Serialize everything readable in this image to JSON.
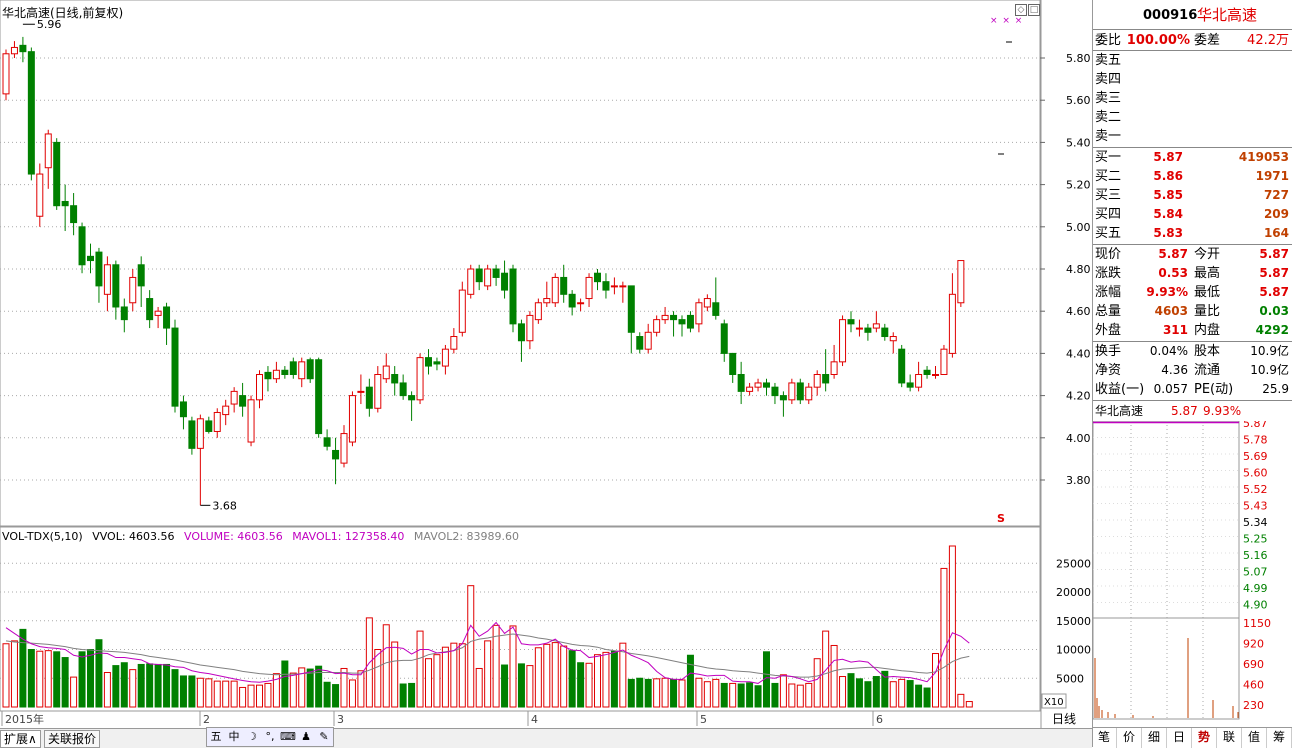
{
  "chart": {
    "title": "华北高速(日线,前复权)",
    "high_label": "5.96",
    "low_label": "3.68",
    "price_ticks": [
      "5.80",
      "5.60",
      "5.40",
      "5.20",
      "5.00",
      "4.80",
      "4.60",
      "4.40",
      "4.20",
      "4.00",
      "3.80"
    ],
    "vol_ticks": [
      "25000",
      "20000",
      "15000",
      "10000",
      "5000"
    ],
    "vol_unit": "X10",
    "x_labels": [
      "2015年",
      "2",
      "3",
      "4",
      "5",
      "6"
    ],
    "period_label": "日线",
    "vol_header": {
      "name": "VOL-TDX(5,10)",
      "vvol": "VVOL: 4603.56",
      "volume": "VOLUME: 4603.56",
      "mavol1": "MAVOL1: 127358.40",
      "mavol2": "MAVOL2: 83989.60"
    },
    "signal": "S",
    "markers": "× × ×",
    "colors": {
      "up": "#e00000",
      "down": "#008000",
      "ma1": "#c000c0",
      "ma2": "#808080"
    }
  },
  "chart_data": {
    "type": "candlestick",
    "title": "华北高速(日线,前复权)",
    "ylim": [
      3.68,
      5.96
    ],
    "candles": [
      [
        5.63,
        5.82,
        5.6,
        5.84
      ],
      [
        5.82,
        5.85,
        5.8,
        5.88
      ],
      [
        5.86,
        5.83,
        5.78,
        5.9
      ],
      [
        5.83,
        5.25,
        5.22,
        5.85
      ],
      [
        5.05,
        5.25,
        5.0,
        5.3
      ],
      [
        5.28,
        5.44,
        5.18,
        5.46
      ],
      [
        5.4,
        5.1,
        5.08,
        5.42
      ],
      [
        5.12,
        5.1,
        4.98,
        5.2
      ],
      [
        5.1,
        5.02,
        4.96,
        5.16
      ],
      [
        5.0,
        4.82,
        4.78,
        5.02
      ],
      [
        4.86,
        4.84,
        4.78,
        4.92
      ],
      [
        4.88,
        4.72,
        4.64,
        4.9
      ],
      [
        4.68,
        4.82,
        4.6,
        4.86
      ],
      [
        4.82,
        4.62,
        4.56,
        4.84
      ],
      [
        4.62,
        4.56,
        4.5,
        4.66
      ],
      [
        4.64,
        4.76,
        4.6,
        4.8
      ],
      [
        4.82,
        4.72,
        4.62,
        4.86
      ],
      [
        4.66,
        4.56,
        4.52,
        4.7
      ],
      [
        4.58,
        4.6,
        4.52,
        4.62
      ],
      [
        4.62,
        4.52,
        4.44,
        4.64
      ],
      [
        4.52,
        4.15,
        4.12,
        4.56
      ],
      [
        4.17,
        4.1,
        4.04,
        4.2
      ],
      [
        4.08,
        3.95,
        3.92,
        4.1
      ],
      [
        3.95,
        4.09,
        3.68,
        4.11
      ],
      [
        4.08,
        4.03,
        4.02,
        4.1
      ],
      [
        4.03,
        4.12,
        4.0,
        4.14
      ],
      [
        4.11,
        4.15,
        4.06,
        4.18
      ],
      [
        4.16,
        4.22,
        4.12,
        4.24
      ],
      [
        4.2,
        4.15,
        4.1,
        4.26
      ],
      [
        3.98,
        4.18,
        3.96,
        4.2
      ],
      [
        4.18,
        4.3,
        4.14,
        4.32
      ],
      [
        4.31,
        4.28,
        4.22,
        4.34
      ],
      [
        4.28,
        4.32,
        4.26,
        4.36
      ],
      [
        4.32,
        4.3,
        4.28,
        4.34
      ],
      [
        4.36,
        4.3,
        4.28,
        4.38
      ],
      [
        4.28,
        4.36,
        4.24,
        4.38
      ],
      [
        4.37,
        4.28,
        4.26,
        4.38
      ],
      [
        4.37,
        4.02,
        4.0,
        4.38
      ],
      [
        4.0,
        3.96,
        3.94,
        4.04
      ],
      [
        3.94,
        3.9,
        3.78,
        4.0
      ],
      [
        3.88,
        4.02,
        3.86,
        4.06
      ],
      [
        3.98,
        4.2,
        3.96,
        4.22
      ],
      [
        4.22,
        4.22,
        4.16,
        4.3
      ],
      [
        4.24,
        4.14,
        4.1,
        4.28
      ],
      [
        4.14,
        4.3,
        4.12,
        4.34
      ],
      [
        4.28,
        4.34,
        4.26,
        4.4
      ],
      [
        4.3,
        4.26,
        4.2,
        4.34
      ],
      [
        4.26,
        4.2,
        4.18,
        4.3
      ],
      [
        4.2,
        4.18,
        4.08,
        4.22
      ],
      [
        4.18,
        4.38,
        4.16,
        4.4
      ],
      [
        4.38,
        4.34,
        4.3,
        4.42
      ],
      [
        4.36,
        4.35,
        4.32,
        4.38
      ],
      [
        4.34,
        4.42,
        4.3,
        4.44
      ],
      [
        4.42,
        4.48,
        4.4,
        4.52
      ],
      [
        4.5,
        4.7,
        4.48,
        4.74
      ],
      [
        4.68,
        4.8,
        4.66,
        4.82
      ],
      [
        4.8,
        4.74,
        4.7,
        4.82
      ],
      [
        4.72,
        4.8,
        4.7,
        4.82
      ],
      [
        4.8,
        4.76,
        4.72,
        4.82
      ],
      [
        4.78,
        4.7,
        4.66,
        4.84
      ],
      [
        4.8,
        4.54,
        4.5,
        4.82
      ],
      [
        4.54,
        4.46,
        4.36,
        4.56
      ],
      [
        4.46,
        4.58,
        4.42,
        4.6
      ],
      [
        4.56,
        4.64,
        4.54,
        4.66
      ],
      [
        4.64,
        4.66,
        4.62,
        4.74
      ],
      [
        4.64,
        4.76,
        4.62,
        4.78
      ],
      [
        4.76,
        4.68,
        4.64,
        4.82
      ],
      [
        4.68,
        4.62,
        4.58,
        4.7
      ],
      [
        4.64,
        4.64,
        4.6,
        4.66
      ],
      [
        4.66,
        4.76,
        4.62,
        4.78
      ],
      [
        4.78,
        4.74,
        4.7,
        4.8
      ],
      [
        4.74,
        4.7,
        4.66,
        4.78
      ],
      [
        4.72,
        4.72,
        4.68,
        4.76
      ],
      [
        4.72,
        4.72,
        4.64,
        4.74
      ],
      [
        4.72,
        4.5,
        4.4,
        4.72
      ],
      [
        4.48,
        4.42,
        4.4,
        4.5
      ],
      [
        4.42,
        4.5,
        4.4,
        4.54
      ],
      [
        4.5,
        4.56,
        4.48,
        4.58
      ],
      [
        4.56,
        4.58,
        4.54,
        4.62
      ],
      [
        4.58,
        4.56,
        4.48,
        4.6
      ],
      [
        4.56,
        4.54,
        4.48,
        4.58
      ],
      [
        4.58,
        4.52,
        4.5,
        4.6
      ],
      [
        4.54,
        4.64,
        4.5,
        4.66
      ],
      [
        4.62,
        4.66,
        4.6,
        4.68
      ],
      [
        4.64,
        4.58,
        4.56,
        4.76
      ],
      [
        4.54,
        4.4,
        4.36,
        4.56
      ],
      [
        4.4,
        4.3,
        4.26,
        4.4
      ],
      [
        4.3,
        4.22,
        4.16,
        4.36
      ],
      [
        4.22,
        4.24,
        4.2,
        4.26
      ],
      [
        4.24,
        4.26,
        4.22,
        4.28
      ],
      [
        4.26,
        4.24,
        4.2,
        4.28
      ],
      [
        4.24,
        4.2,
        4.16,
        4.26
      ],
      [
        4.2,
        4.18,
        4.1,
        4.22
      ],
      [
        4.18,
        4.26,
        4.16,
        4.28
      ],
      [
        4.26,
        4.18,
        4.16,
        4.28
      ],
      [
        4.18,
        4.24,
        4.16,
        4.26
      ],
      [
        4.24,
        4.3,
        4.2,
        4.32
      ],
      [
        4.3,
        4.26,
        4.22,
        4.42
      ],
      [
        4.3,
        4.36,
        4.28,
        4.44
      ],
      [
        4.36,
        4.56,
        4.34,
        4.58
      ],
      [
        4.56,
        4.54,
        4.5,
        4.6
      ],
      [
        4.52,
        4.52,
        4.48,
        4.56
      ],
      [
        4.52,
        4.5,
        4.46,
        4.54
      ],
      [
        4.52,
        4.54,
        4.5,
        4.6
      ],
      [
        4.52,
        4.48,
        4.46,
        4.54
      ],
      [
        4.46,
        4.48,
        4.4,
        4.5
      ],
      [
        4.42,
        4.26,
        4.24,
        4.44
      ],
      [
        4.26,
        4.24,
        4.22,
        4.3
      ],
      [
        4.24,
        4.3,
        4.22,
        4.36
      ],
      [
        4.32,
        4.3,
        4.28,
        4.34
      ],
      [
        4.3,
        4.3,
        4.28,
        4.34
      ],
      [
        4.3,
        4.42,
        4.3,
        4.44
      ],
      [
        4.4,
        4.68,
        4.38,
        4.78
      ],
      [
        4.64,
        4.84,
        4.62,
        4.84
      ]
    ],
    "volumes": [
      [
        11000,
        1
      ],
      [
        11500,
        1
      ],
      [
        13500,
        0
      ],
      [
        10000,
        0
      ],
      [
        9700,
        1
      ],
      [
        9800,
        1
      ],
      [
        9600,
        0
      ],
      [
        8600,
        0
      ],
      [
        5200,
        1
      ],
      [
        9600,
        0
      ],
      [
        10000,
        0
      ],
      [
        11700,
        0
      ],
      [
        6000,
        1
      ],
      [
        7200,
        0
      ],
      [
        7700,
        0
      ],
      [
        6500,
        1
      ],
      [
        7400,
        0
      ],
      [
        7500,
        0
      ],
      [
        7400,
        0
      ],
      [
        7400,
        0
      ],
      [
        6500,
        0
      ],
      [
        5400,
        0
      ],
      [
        5400,
        0
      ],
      [
        5000,
        1
      ],
      [
        4900,
        1
      ],
      [
        4500,
        1
      ],
      [
        4500,
        1
      ],
      [
        4500,
        1
      ],
      [
        3400,
        1
      ],
      [
        3800,
        1
      ],
      [
        3800,
        1
      ],
      [
        4100,
        1
      ],
      [
        5800,
        1
      ],
      [
        8000,
        0
      ],
      [
        5900,
        1
      ],
      [
        6800,
        1
      ],
      [
        6600,
        0
      ],
      [
        7100,
        0
      ],
      [
        4300,
        0
      ],
      [
        3900,
        0
      ],
      [
        6700,
        1
      ],
      [
        4700,
        1
      ],
      [
        6300,
        1
      ],
      [
        15500,
        1
      ],
      [
        10000,
        1
      ],
      [
        14300,
        1
      ],
      [
        11300,
        1
      ],
      [
        4000,
        0
      ],
      [
        4100,
        0
      ],
      [
        13200,
        1
      ],
      [
        8400,
        1
      ],
      [
        9100,
        1
      ],
      [
        10400,
        1
      ],
      [
        11100,
        1
      ],
      [
        11000,
        1
      ],
      [
        21100,
        1
      ],
      [
        6700,
        1
      ],
      [
        11500,
        1
      ],
      [
        14200,
        1
      ],
      [
        7300,
        0
      ],
      [
        14100,
        1
      ],
      [
        7500,
        0
      ],
      [
        7200,
        1
      ],
      [
        10300,
        1
      ],
      [
        10900,
        1
      ],
      [
        11200,
        1
      ],
      [
        10600,
        1
      ],
      [
        9800,
        0
      ],
      [
        7700,
        0
      ],
      [
        7600,
        1
      ],
      [
        9100,
        1
      ],
      [
        9500,
        1
      ],
      [
        9700,
        0
      ],
      [
        11100,
        1
      ],
      [
        4800,
        0
      ],
      [
        5000,
        0
      ],
      [
        4800,
        0
      ],
      [
        4900,
        1
      ],
      [
        5000,
        1
      ],
      [
        4800,
        0
      ],
      [
        4700,
        1
      ],
      [
        9000,
        0
      ],
      [
        5000,
        1
      ],
      [
        4400,
        1
      ],
      [
        4800,
        1
      ],
      [
        4100,
        0
      ],
      [
        4100,
        1
      ],
      [
        4000,
        0
      ],
      [
        4200,
        0
      ],
      [
        3700,
        0
      ],
      [
        9600,
        0
      ],
      [
        4100,
        0
      ],
      [
        5600,
        1
      ],
      [
        4000,
        1
      ],
      [
        3800,
        1
      ],
      [
        4100,
        1
      ],
      [
        8400,
        1
      ],
      [
        13200,
        1
      ],
      [
        10700,
        1
      ],
      [
        5300,
        1
      ],
      [
        5800,
        0
      ],
      [
        4900,
        0
      ],
      [
        4400,
        0
      ],
      [
        5300,
        0
      ],
      [
        6200,
        0
      ],
      [
        4400,
        1
      ],
      [
        4800,
        1
      ],
      [
        4600,
        0
      ],
      [
        3800,
        0
      ],
      [
        3300,
        0
      ],
      [
        9300,
        1
      ],
      [
        24100,
        1
      ],
      [
        28000,
        1
      ],
      [
        2200,
        1
      ],
      [
        950,
        1
      ]
    ],
    "mavol1": [
      13800,
      12800,
      11800,
      11000,
      10500,
      10300,
      10200,
      10000,
      9000,
      8700,
      9000,
      9400,
      9300,
      8600,
      8600,
      8400,
      8200,
      7500,
      7400,
      7300,
      7000,
      6900,
      6300,
      6000,
      5800,
      5500,
      5200,
      4900,
      4600,
      4400,
      4300,
      4500,
      4800,
      5300,
      5500,
      5800,
      6100,
      6500,
      6300,
      5800,
      5900,
      5600,
      5600,
      7700,
      9100,
      10300,
      10400,
      10200,
      9200,
      10000,
      10000,
      9400,
      9500,
      9800,
      11000,
      14200,
      12300,
      13200,
      14700,
      12800,
      13900,
      11000,
      10800,
      10800,
      11100,
      11800,
      10500,
      9900,
      9800,
      8600,
      8800,
      9100,
      9500,
      9900,
      9000,
      8400,
      7700,
      6200,
      5100,
      4800,
      4800,
      5900,
      5700,
      5400,
      5500,
      5500,
      4500,
      4400,
      4400,
      4100,
      5100,
      5000,
      5500,
      5300,
      4900,
      4400,
      4800,
      6400,
      8100,
      8300,
      7800,
      8000,
      7800,
      6500,
      5200,
      5300,
      5200,
      5100,
      4800,
      4400,
      6000,
      9900,
      12900,
      12300,
      11100
    ],
    "mavol2": [
      11500,
      11300,
      11200,
      11100,
      11000,
      10900,
      10700,
      10500,
      10200,
      10000,
      9900,
      9800,
      9700,
      9600,
      9500,
      9300,
      9100,
      8800,
      8600,
      8400,
      8200,
      7900,
      7600,
      7300,
      7100,
      6900,
      6700,
      6500,
      6200,
      6000,
      5800,
      5700,
      5600,
      5700,
      5700,
      5800,
      5900,
      6000,
      6000,
      6000,
      6000,
      5900,
      5900,
      6400,
      7000,
      7700,
      8000,
      8100,
      8100,
      8500,
      9100,
      9400,
      9600,
      9800,
      10300,
      11400,
      11800,
      12000,
      12300,
      12500,
      12700,
      12500,
      12300,
      12000,
      11800,
      11500,
      11200,
      10900,
      10700,
      10600,
      10400,
      10000,
      9800,
      9600,
      9300,
      9100,
      8900,
      8600,
      8300,
      8000,
      7700,
      7400,
      7100,
      6800,
      6600,
      6500,
      6300,
      6200,
      6100,
      5900,
      5700,
      5500,
      5400,
      5300,
      5200,
      5200,
      5400,
      5800,
      6300,
      6600,
      6700,
      6800,
      6900,
      6900,
      6700,
      6500,
      6300,
      6200,
      6000,
      5900,
      6100,
      6900,
      7900,
      8500,
      8800
    ]
  },
  "quote": {
    "code": "000916",
    "name": "华北高速",
    "weibi_label": "委比",
    "weibi_value": "100.00%",
    "weicha_label": "委差",
    "weicha_value": "42.2万",
    "sell": [
      {
        "label": "卖五",
        "price": "",
        "vol": ""
      },
      {
        "label": "卖四",
        "price": "",
        "vol": ""
      },
      {
        "label": "卖三",
        "price": "",
        "vol": ""
      },
      {
        "label": "卖二",
        "price": "",
        "vol": ""
      },
      {
        "label": "卖一",
        "price": "",
        "vol": ""
      }
    ],
    "buy": [
      {
        "label": "买一",
        "price": "5.87",
        "vol": "419053"
      },
      {
        "label": "买二",
        "price": "5.86",
        "vol": "1971"
      },
      {
        "label": "买三",
        "price": "5.85",
        "vol": "727"
      },
      {
        "label": "买四",
        "price": "5.84",
        "vol": "209"
      },
      {
        "label": "买五",
        "price": "5.83",
        "vol": "164"
      }
    ],
    "stats": [
      {
        "l1": "现价",
        "v1": "5.87",
        "l2": "今开",
        "v2": "5.87",
        "c1": "red",
        "c2": "red"
      },
      {
        "l1": "涨跌",
        "v1": "0.53",
        "l2": "最高",
        "v2": "5.87",
        "c1": "red",
        "c2": "red"
      },
      {
        "l1": "涨幅",
        "v1": "9.93%",
        "l2": "最低",
        "v2": "5.87",
        "c1": "red",
        "c2": "red"
      },
      {
        "l1": "总量",
        "v1": "4603",
        "l2": "量比",
        "v2": "0.03",
        "c1": "orn",
        "c2": "green"
      },
      {
        "l1": "外盘",
        "v1": "311",
        "l2": "内盘",
        "v2": "4292",
        "c1": "red",
        "c2": "green"
      }
    ],
    "fin": [
      {
        "l1": "换手",
        "v1": "0.04%",
        "l2": "股本",
        "v2": "10.9亿"
      },
      {
        "l1": "净资",
        "v1": "4.36",
        "l2": "流通",
        "v2": "10.9亿"
      },
      {
        "l1": "收益(一)",
        "v1": "0.057",
        "l2": "PE(动)",
        "v2": "25.9"
      }
    ],
    "intraday_title": "华北高速",
    "intraday_price": "5.87",
    "intraday_pct": "9.93%",
    "intraday_price_ticks": [
      "5.87",
      "5.78",
      "5.69",
      "5.60",
      "5.52",
      "5.43",
      "5.34",
      "5.25",
      "5.16",
      "5.07",
      "4.99",
      "4.90"
    ],
    "intraday_vol_ticks": [
      "1150",
      "920",
      "690",
      "460",
      "230"
    ],
    "tabs": [
      "笔",
      "价",
      "细",
      "日",
      "势",
      "联",
      "值",
      "筹"
    ],
    "active_tab": "势"
  },
  "bottom": {
    "tabs": [
      "扩展∧",
      "关联报价"
    ],
    "ime": [
      "五",
      "中",
      "☽",
      "°,",
      "⌨",
      "♟",
      "✎"
    ]
  }
}
